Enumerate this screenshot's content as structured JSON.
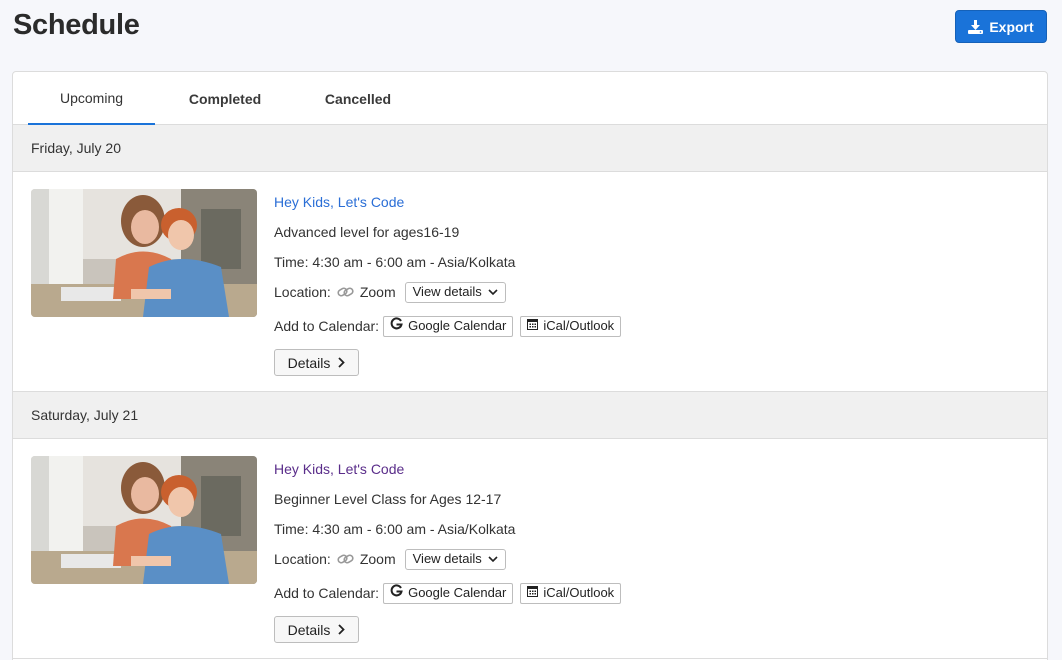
{
  "page": {
    "title": "Schedule"
  },
  "header": {
    "export_label": "Export"
  },
  "tabs": [
    {
      "label": "Upcoming",
      "active": true
    },
    {
      "label": "Completed",
      "active": false
    },
    {
      "label": "Cancelled",
      "active": false
    }
  ],
  "events": [
    {
      "date": "Friday, July 20",
      "title": "Hey Kids, Let's Code",
      "level": "Advanced level for ages16-19",
      "time": "Time: 4:30 am - 6:00 am - Asia/Kolkata",
      "location_label": "Location:",
      "location_value": "Zoom",
      "view_details": "View details",
      "calendar_label": "Add to Calendar:",
      "google_calendar": "Google Calendar",
      "ical": "iCal/Outlook",
      "details": "Details"
    },
    {
      "date": "Saturday, July 21",
      "title": "Hey Kids, Let's Code",
      "level": "Beginner Level Class for Ages 12-17",
      "time": "Time: 4:30 am - 6:00 am - Asia/Kolkata",
      "location_label": "Location:",
      "location_value": "Zoom",
      "view_details": "View details",
      "calendar_label": "Add to Calendar:",
      "google_calendar": "Google Calendar",
      "ical": "iCal/Outlook",
      "details": "Details"
    }
  ],
  "colors": {
    "accent": "#1a73d9",
    "link": "#2a6ed6",
    "visited_link": "#5a2d8a"
  },
  "icons": [
    "download-icon",
    "link-icon",
    "chevron-down-icon",
    "google-g-icon",
    "calendar-icon",
    "chevron-right-icon"
  ]
}
